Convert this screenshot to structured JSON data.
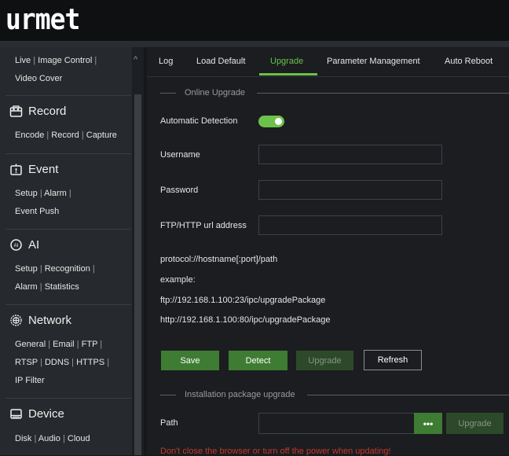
{
  "app": {
    "logo": "urmet"
  },
  "sidebar": {
    "collapse_arrow": "^",
    "sections": [
      {
        "title": "",
        "icon": "",
        "links": [
          "Live",
          "Image Control",
          "Video Cover"
        ]
      },
      {
        "title": "Record",
        "icon": "record-icon",
        "links": [
          "Encode",
          "Record",
          "Capture"
        ]
      },
      {
        "title": "Event",
        "icon": "event-icon",
        "links": [
          "Setup",
          "Alarm",
          "Event Push"
        ]
      },
      {
        "title": "AI",
        "icon": "ai-icon",
        "links": [
          "Setup",
          "Recognition",
          "Alarm",
          "Statistics"
        ]
      },
      {
        "title": "Network",
        "icon": "network-icon",
        "links": [
          "General",
          "Email",
          "FTP",
          "RTSP",
          "DDNS",
          "HTTPS",
          "IP Filter"
        ]
      },
      {
        "title": "Device",
        "icon": "device-icon",
        "links": [
          "Disk",
          "Audio",
          "Cloud"
        ]
      }
    ]
  },
  "tabs": [
    "Log",
    "Load Default",
    "Upgrade",
    "Parameter Management",
    "Auto Reboot"
  ],
  "active_tab": "Upgrade",
  "online_upgrade": {
    "legend": "Online Upgrade",
    "auto_detection_label": "Automatic Detection",
    "auto_detection_on": true,
    "username_label": "Username",
    "username_value": "",
    "password_label": "Password",
    "password_value": "",
    "url_label": "FTP/HTTP url address",
    "url_value": "",
    "protocol_hint": "protocol://hostname[:port]/path",
    "example_label": "example:",
    "example_ftp": "ftp://192.168.1.100:23/ipc/upgradePackage",
    "example_http": "http://192.168.1.100:80/ipc/upgradePackage",
    "buttons": {
      "save": "Save",
      "detect": "Detect",
      "upgrade": "Upgrade",
      "refresh": "Refresh"
    }
  },
  "package_upgrade": {
    "legend": "Installation package upgrade",
    "path_label": "Path",
    "path_value": "",
    "browse_label": "•••",
    "upgrade_label": "Upgrade",
    "warning": "Don't close the browser or turn off the power when updating!"
  },
  "colors": {
    "accent": "#6cc24a",
    "button_green": "#3f7c33",
    "warning": "#c0392b"
  }
}
